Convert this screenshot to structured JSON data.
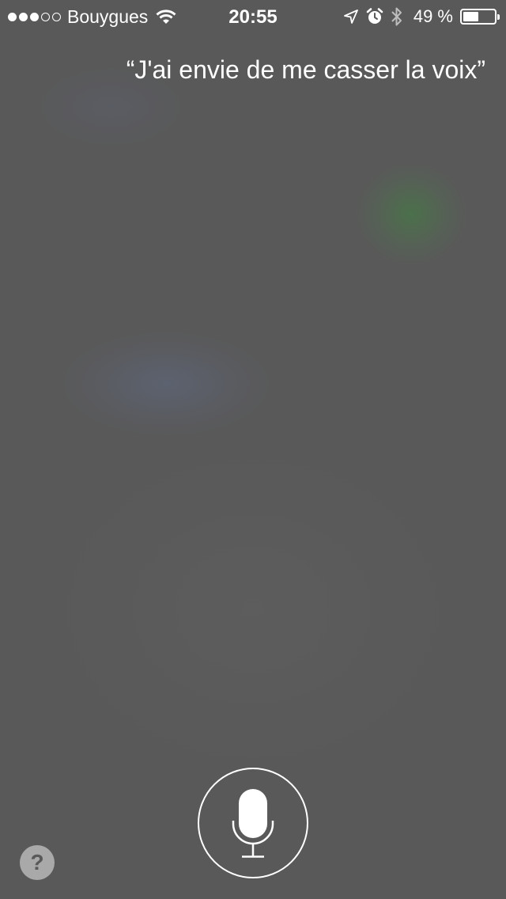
{
  "status_bar": {
    "signal_dots_filled": 3,
    "signal_dots_total": 5,
    "carrier": "Bouygues",
    "time": "20:55",
    "battery_percent": "49 %",
    "battery_level": 0.49,
    "icons": [
      "wifi-icon",
      "location-arrow-icon",
      "alarm-clock-icon",
      "bluetooth-icon",
      "battery-icon"
    ]
  },
  "siri": {
    "query": "“J'ai envie de me casser la voix”"
  },
  "controls": {
    "mic_icon": "microphone-icon",
    "help_label": "?"
  },
  "colors": {
    "background": "#595959",
    "text": "#ffffff",
    "help_button": "#a9a9a9"
  }
}
